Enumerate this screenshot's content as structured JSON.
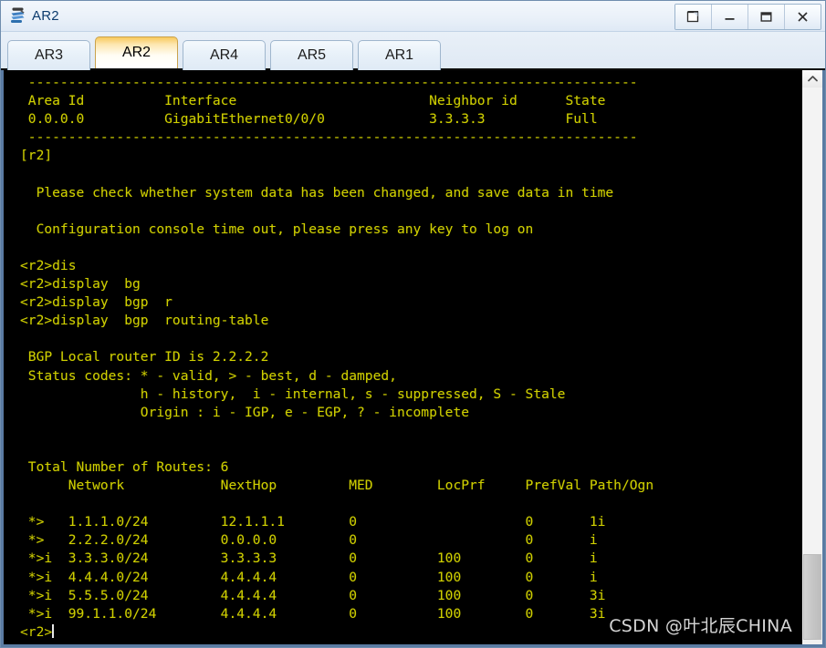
{
  "window": {
    "title": "AR2",
    "icon": "router-device-icon",
    "caption_buttons": [
      {
        "name": "restore-window-button",
        "glyph": "❐",
        "label": "Restore"
      },
      {
        "name": "minimize-window-button",
        "glyph": "—",
        "label": "Minimize"
      },
      {
        "name": "maximize-window-button",
        "glyph": "❒",
        "label": "Maximize"
      },
      {
        "name": "close-window-button",
        "glyph": "X",
        "label": "Close"
      }
    ]
  },
  "tabs": {
    "active": "AR2",
    "items": [
      {
        "label": "AR3",
        "active": false
      },
      {
        "label": "AR2",
        "active": true
      },
      {
        "label": "AR4",
        "active": false
      },
      {
        "label": "AR5",
        "active": false
      },
      {
        "label": "AR1",
        "active": false
      }
    ]
  },
  "terminal": {
    "foreground_color": "#cfcf00",
    "background_color": "#000000",
    "cursor_visible": true,
    "prompt": "<r2>",
    "ospf_neighbor_table": {
      "separator": "----------------------------------------------------------------------------",
      "headers": [
        "Area Id",
        "Interface",
        "Neighbor id",
        "State"
      ],
      "rows": [
        [
          "0.0.0.0",
          "GigabitEthernet0/0/0",
          "3.3.3.3",
          "Full"
        ]
      ]
    },
    "system_prompt_context": "[r2]",
    "messages": [
      "  Please check whether system data has been changed, and save data in time",
      "  Configuration console time out, please press any key to log on"
    ],
    "command_history": [
      "<r2>dis",
      "<r2>display  bg",
      "<r2>display  bgp  r",
      "<r2>display  bgp  routing-table"
    ],
    "bgp": {
      "router_id_line": " BGP Local router ID is 2.2.2.2",
      "status_codes_lines": [
        " Status codes: * - valid, > - best, d - damped,",
        "               h - history,  i - internal, s - suppressed, S - Stale",
        "               Origin : i - IGP, e - EGP, ? - incomplete"
      ],
      "total_routes_label": "Total Number of Routes:",
      "total_routes": "6",
      "columns": [
        "Network",
        "NextHop",
        "MED",
        "LocPrf",
        "PrefVal",
        "Path/Ogn"
      ],
      "routes": [
        {
          "status": "*>",
          "network": "1.1.1.0/24",
          "nexthop": "12.1.1.1",
          "med": "0",
          "locprf": "",
          "prefval": "0",
          "path_ogn": "1i"
        },
        {
          "status": "*>",
          "network": "2.2.2.0/24",
          "nexthop": "0.0.0.0",
          "med": "0",
          "locprf": "",
          "prefval": "0",
          "path_ogn": "i"
        },
        {
          "status": "*>i",
          "network": "3.3.3.0/24",
          "nexthop": "3.3.3.3",
          "med": "0",
          "locprf": "100",
          "prefval": "0",
          "path_ogn": "i"
        },
        {
          "status": "*>i",
          "network": "4.4.4.0/24",
          "nexthop": "4.4.4.4",
          "med": "0",
          "locprf": "100",
          "prefval": "0",
          "path_ogn": "i"
        },
        {
          "status": "*>i",
          "network": "5.5.5.0/24",
          "nexthop": "4.4.4.4",
          "med": "0",
          "locprf": "100",
          "prefval": "0",
          "path_ogn": "3i"
        },
        {
          "status": "*>i",
          "network": "99.1.1.0/24",
          "nexthop": "4.4.4.4",
          "med": "0",
          "locprf": "100",
          "prefval": "0",
          "path_ogn": "3i"
        }
      ]
    },
    "screen_text": " ----------------------------------------------------------------------------\n Area Id          Interface                        Neighbor id      State\n 0.0.0.0          GigabitEthernet0/0/0             3.3.3.3          Full\n ----------------------------------------------------------------------------\n[r2]\n\n  Please check whether system data has been changed, and save data in time\n\n  Configuration console time out, please press any key to log on\n\n<r2>dis\n<r2>display  bg\n<r2>display  bgp  r\n<r2>display  bgp  routing-table\n\n BGP Local router ID is 2.2.2.2\n Status codes: * - valid, > - best, d - damped,\n               h - history,  i - internal, s - suppressed, S - Stale\n               Origin : i - IGP, e - EGP, ? - incomplete\n\n\n Total Number of Routes: 6\n      Network            NextHop         MED        LocPrf     PrefVal Path/Ogn\n\n *>   1.1.1.0/24         12.1.1.1        0                     0       1i\n *>   2.2.2.0/24         0.0.0.0         0                     0       i\n *>i  3.3.3.0/24         3.3.3.3         0          100        0       i\n *>i  4.4.4.0/24         4.4.4.4         0          100        0       i\n *>i  5.5.5.0/24         4.4.4.4         0          100        0       3i\n *>i  99.1.1.0/24        4.4.4.4         0          100        0       3i\n"
  },
  "watermark": {
    "text": "CSDN @叶北辰CHINA"
  },
  "scrollbar": {
    "up_arrow": "scroll-up-arrow-icon",
    "thumb_name": "scroll-thumb"
  }
}
